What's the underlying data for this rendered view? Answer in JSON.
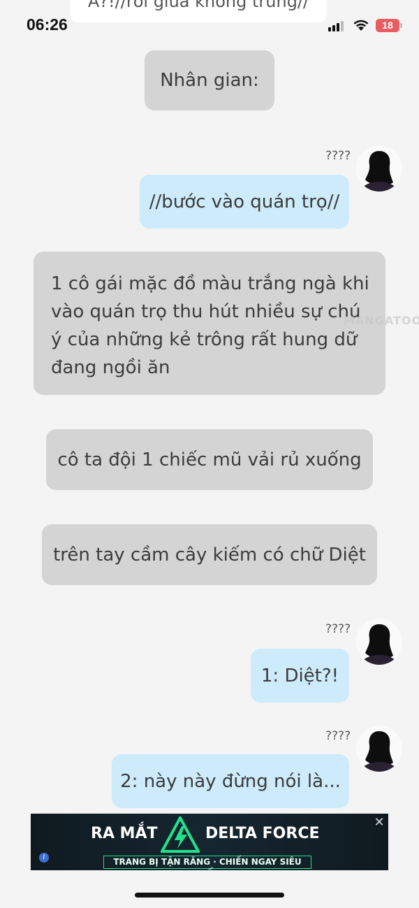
{
  "top_fragment": "A?!//rơi giữa không trung//",
  "status_bar": {
    "time": "06:26",
    "battery": "18"
  },
  "messages": [
    {
      "text": "Nhân gian:"
    },
    {
      "sender": "????",
      "text": "//bước vào quán trọ//"
    },
    {
      "text": "1 cô gái mặc đồ màu trắng ngà khi vào quán trọ thu hút nhiều sự chú ý của những kẻ trông rất hung dữ đang ngồi ăn"
    },
    {
      "text": "cô ta đội 1 chiếc mũ vải rủ xuống"
    },
    {
      "text": "trên tay cầm cây kiếm có chữ Diệt"
    },
    {
      "sender": "????",
      "text": "1: Diệt?!"
    },
    {
      "sender": "????",
      "text": "2: này này đừng nói là..."
    }
  ],
  "watermark": "MANGATOON",
  "ad": {
    "headline_left": "RA MẮT",
    "headline_right": "DELTA FORCE",
    "subline": "TRANG BỊ TẬN RĂNG · CHIẾN NGAY SIÊU PHẨM",
    "close_icon": "close-icon",
    "info_icon": "info-icon",
    "accent": "#21e28c"
  },
  "colors": {
    "narration_bubble": "#d4d4d4",
    "user_bubble": "#cdebfa",
    "background": "#f4f4f4"
  }
}
